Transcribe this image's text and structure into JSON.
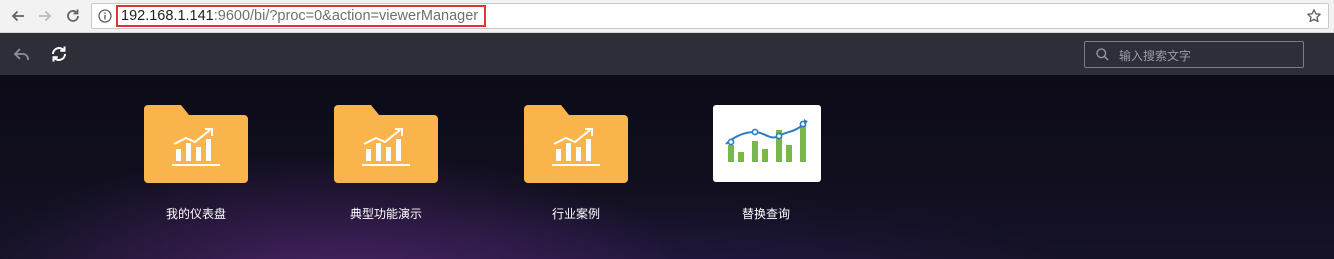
{
  "browser": {
    "url_host": "192.168.1.141",
    "url_path": ":9600/bi/?proc=0&action=viewerManager"
  },
  "search": {
    "placeholder": "输入搜索文字"
  },
  "tiles": [
    {
      "label": "我的仪表盘",
      "icon": "folder-chart-icon"
    },
    {
      "label": "典型功能演示",
      "icon": "folder-chart-icon"
    },
    {
      "label": "行业案例",
      "icon": "folder-chart-icon"
    },
    {
      "label": "替换查询",
      "icon": "report-chart-icon"
    }
  ],
  "colors": {
    "folder": "#f9b54c",
    "toolbar": "#2c2e38",
    "bar_green": "#7ab648",
    "line_blue": "#2e7cc4",
    "url_highlight": "#e03434"
  }
}
